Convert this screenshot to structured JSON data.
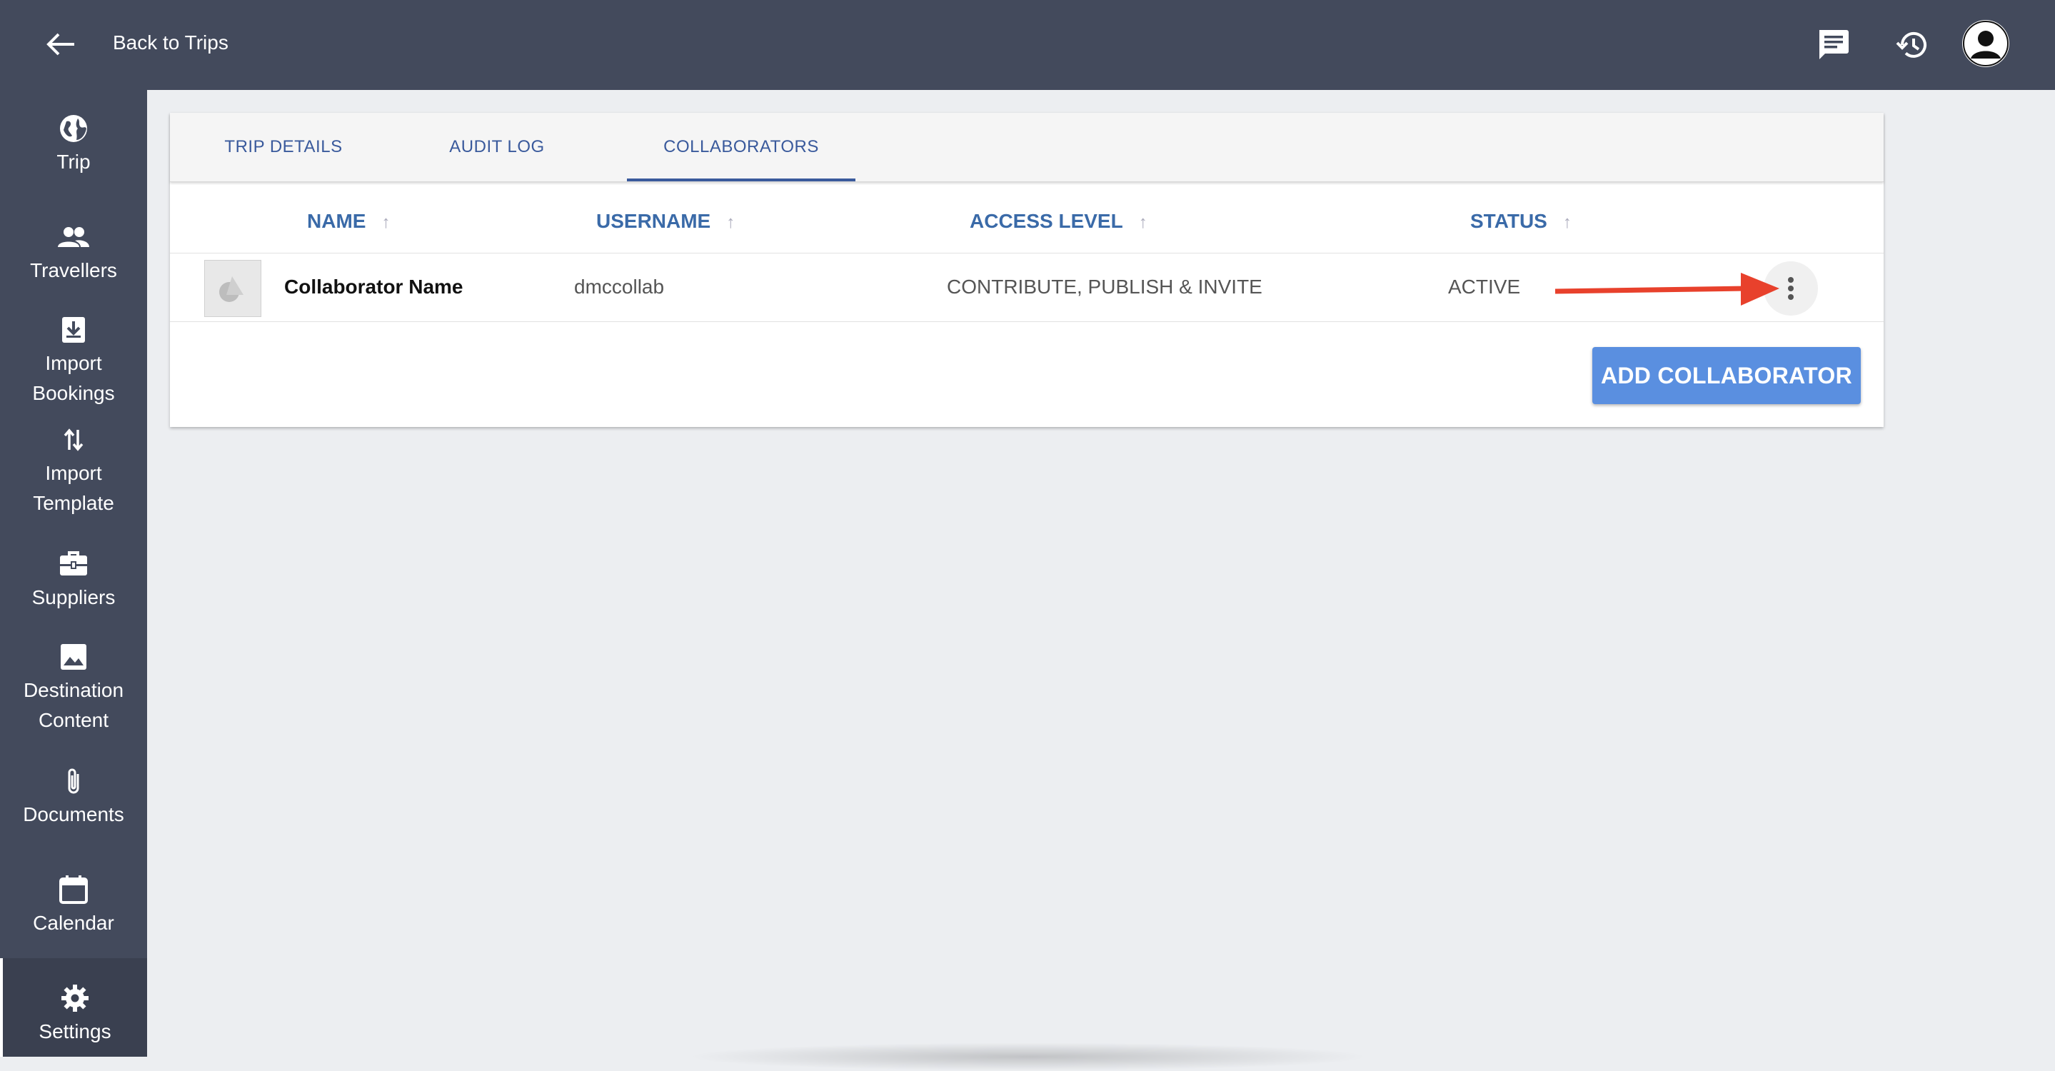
{
  "topbar": {
    "back_label": "Back to Trips",
    "icons": [
      "arrow-left-icon",
      "chat-icon",
      "history-icon",
      "user-avatar"
    ]
  },
  "sidebar": {
    "items": [
      {
        "label": "Trip",
        "icon": "globe-icon"
      },
      {
        "label": "Travellers",
        "icon": "people-icon"
      },
      {
        "label": "Import\nBookings",
        "icon": "download-box-icon"
      },
      {
        "label": "Import\nTemplate",
        "icon": "swap-vertical-icon"
      },
      {
        "label": "Suppliers",
        "icon": "briefcase-icon"
      },
      {
        "label": "Destination\nContent",
        "icon": "image-icon"
      },
      {
        "label": "Documents",
        "icon": "paperclip-icon"
      },
      {
        "label": "Calendar",
        "icon": "calendar-icon"
      },
      {
        "label": "Settings",
        "icon": "gear-icon",
        "active": true
      }
    ]
  },
  "tabs": [
    {
      "label": "TRIP DETAILS"
    },
    {
      "label": "AUDIT LOG"
    },
    {
      "label": "COLLABORATORS",
      "active": true
    }
  ],
  "table": {
    "columns": [
      "NAME",
      "USERNAME",
      "ACCESS LEVEL",
      "STATUS"
    ],
    "rows": [
      {
        "name": "Collaborator Name",
        "username": "dmccollab",
        "access_level": "CONTRIBUTE, PUBLISH & INVITE",
        "status": "ACTIVE"
      }
    ]
  },
  "add_button_label": "ADD COLLABORATOR",
  "colors": {
    "topbar": "#434a5c",
    "accent_text": "#3a6aa8",
    "button": "#5a8fe0",
    "annotation_arrow": "#e8412c"
  }
}
